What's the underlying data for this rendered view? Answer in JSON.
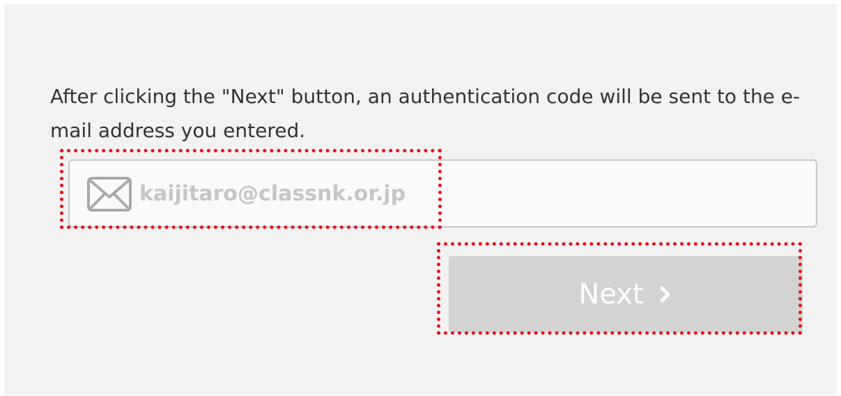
{
  "instructions": {
    "text": "After clicking the \"Next\" button, an authentication code will be sent to the e-mail address you entered."
  },
  "email_field": {
    "icon": "mail-icon",
    "placeholder": "kaijitaro@classnk.or.jp",
    "value": ""
  },
  "next_button": {
    "label": "Next",
    "icon": "chevron-right-icon",
    "enabled": false
  },
  "highlights": {
    "color": "#e8101a",
    "style": "dotted"
  }
}
